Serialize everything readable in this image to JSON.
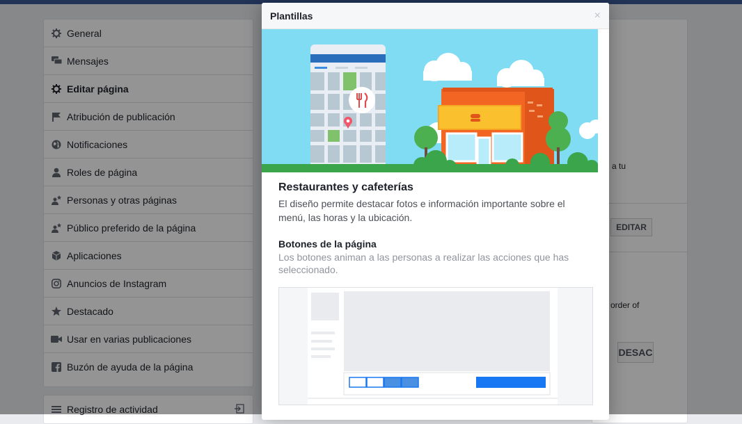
{
  "sidebar": {
    "items": [
      {
        "label": "General",
        "icon": "gear-icon"
      },
      {
        "label": "Mensajes",
        "icon": "chat-icon"
      },
      {
        "label": "Editar página",
        "icon": "gear-icon",
        "active": true
      },
      {
        "label": "Atribución de publicación",
        "icon": "flag-icon"
      },
      {
        "label": "Notificaciones",
        "icon": "globe-icon"
      },
      {
        "label": "Roles de página",
        "icon": "person-icon"
      },
      {
        "label": "Personas y otras páginas",
        "icon": "person-star-icon"
      },
      {
        "label": "Público preferido de la página",
        "icon": "person-star-icon"
      },
      {
        "label": "Aplicaciones",
        "icon": "cube-icon"
      },
      {
        "label": "Anuncios de Instagram",
        "icon": "instagram-icon"
      },
      {
        "label": "Destacado",
        "icon": "star-icon"
      },
      {
        "label": "Usar en varias publicaciones",
        "icon": "video-icon"
      },
      {
        "label": "Buzón de ayuda de la página",
        "icon": "facebook-icon"
      }
    ],
    "activity_log": "Registro de actividad"
  },
  "right_panel": {
    "text1": "a tu",
    "edit_button": "EDITAR",
    "text2": "order of",
    "deact_button": "DESAC"
  },
  "modal": {
    "title": "Plantillas",
    "close": "×",
    "template_title": "Restaurantes y cafeterías",
    "template_desc": "El diseño permite destacar fotos e información importante sobre el menú, las horas y la ubicación.",
    "buttons_title": "Botones de la página",
    "buttons_desc": "Los botones animan a las personas a realizar las acciones que has seleccionado."
  },
  "colors": {
    "sky": "#7fdcf3",
    "grass": "#3aa54a",
    "building": "#f26522",
    "awning": "#fbc02d",
    "fb_blue": "#1877f2"
  }
}
